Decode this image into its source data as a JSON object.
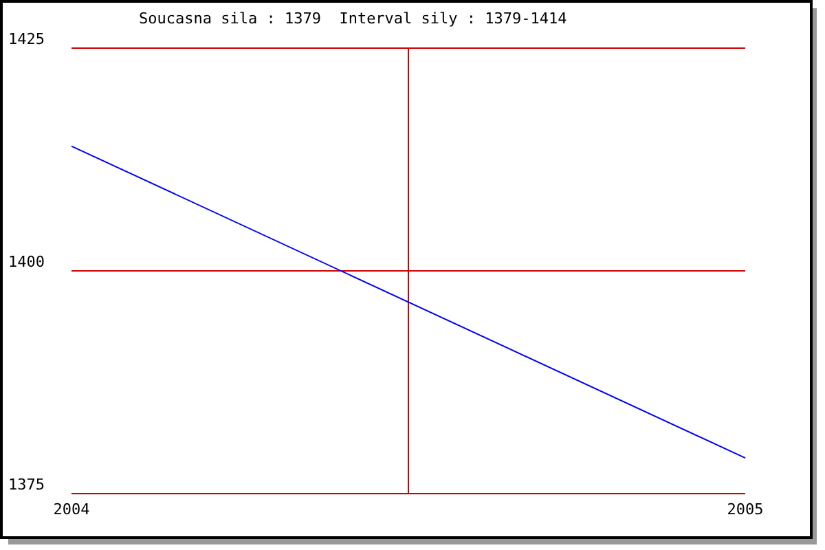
{
  "chart_data": {
    "type": "line",
    "title": "Soucasna sila : 1379  Interval sily : 1379-1414",
    "x": [
      2004,
      2005
    ],
    "series": [
      {
        "color": "#0000ff",
        "values": [
          1414,
          1379
        ]
      }
    ],
    "xlim": [
      2004,
      2005
    ],
    "ylim": [
      1375,
      1425
    ],
    "xticks": [
      2004,
      2005
    ],
    "yticks": [
      1375,
      1400,
      1425
    ],
    "ref_lines": [
      {
        "axis": "y",
        "value": 1400,
        "color": "#cc0000"
      },
      {
        "axis": "x",
        "value": 2004.5,
        "color": "#cc0000"
      }
    ]
  }
}
